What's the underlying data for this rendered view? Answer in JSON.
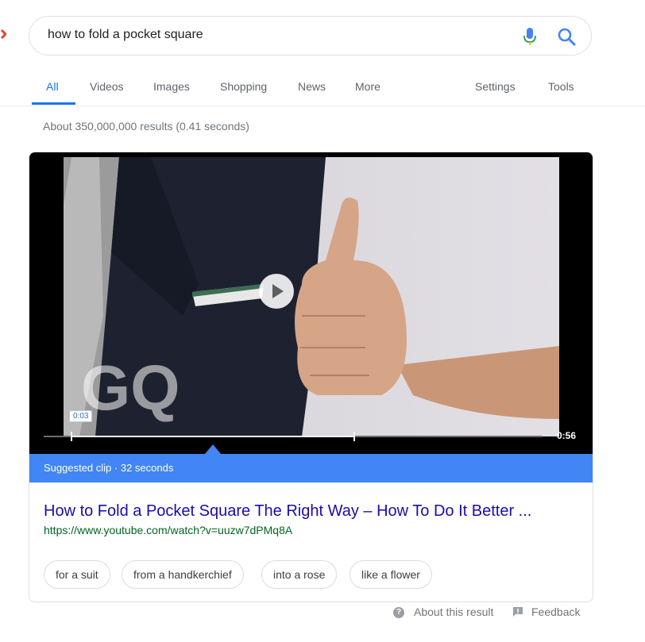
{
  "search": {
    "query": "how to fold a pocket square"
  },
  "tabs": [
    {
      "label": "All",
      "active": true
    },
    {
      "label": "Videos"
    },
    {
      "label": "Images"
    },
    {
      "label": "Shopping"
    },
    {
      "label": "News"
    },
    {
      "label": "More"
    }
  ],
  "tools": {
    "settings": "Settings",
    "tools": "Tools"
  },
  "result_stats": "About 350,000,000 results (0.41 seconds)",
  "video": {
    "watermark": "GQ",
    "current_time": "0:03",
    "duration": "0:56",
    "clip_label": "Suggested clip · 32 seconds",
    "clip_start_fraction": 0.054,
    "clip_end_fraction": 0.62
  },
  "result": {
    "title": "How to Fold a Pocket Square The Right Way – How To Do It Better ...",
    "url": "https://www.youtube.com/watch?v=uuzw7dPMq8A"
  },
  "chips": [
    {
      "label": "for a suit"
    },
    {
      "label": "from a handkerchief"
    },
    {
      "label": "into a rose"
    },
    {
      "label": "like a flower"
    }
  ],
  "footer": {
    "about": "About this result",
    "feedback": "Feedback"
  },
  "colors": {
    "accent": "#1a73e8",
    "link": "#1a0dab",
    "url": "#006621",
    "clip_bar": "#4285f4"
  },
  "icons": [
    "mic-icon",
    "search-icon",
    "play-icon",
    "help-icon",
    "feedback-icon"
  ]
}
